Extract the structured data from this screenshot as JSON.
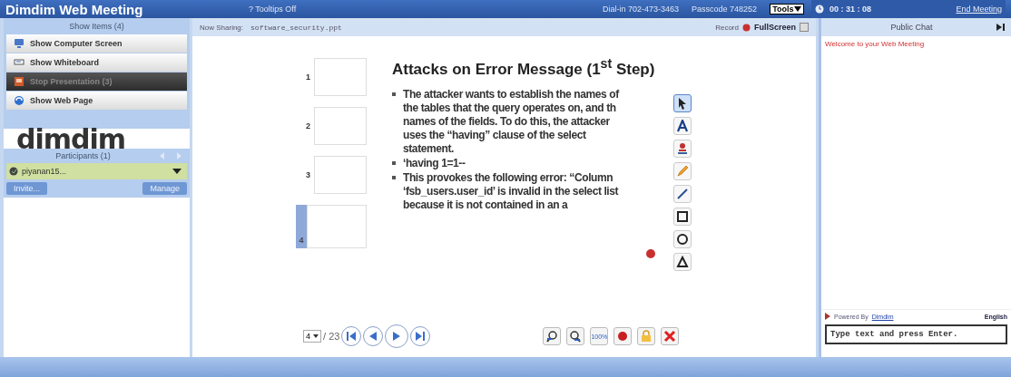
{
  "window": {
    "title": "Dimdim Web Meeting"
  },
  "header": {
    "tooltips": "? Tooltips Off",
    "dial_in": "Dial-in  702-473-3463",
    "passcode": "Passcode  748252",
    "tools": "Tools",
    "timer": "00 : 31 : 08",
    "end_meeting": "End Meeting"
  },
  "show_items": {
    "title": "Show Items (4)",
    "items": [
      {
        "kind": "screen",
        "label": "Show Computer Screen",
        "selected": false
      },
      {
        "kind": "whiteboard",
        "label": "Show Whiteboard",
        "selected": false
      },
      {
        "kind": "presentation",
        "label": "Stop Presentation (3)",
        "selected": true
      },
      {
        "kind": "web",
        "label": "Show Web Page",
        "selected": false
      }
    ]
  },
  "logo": "dimdim",
  "participants": {
    "title": "Participants (1)",
    "people": [
      {
        "name": "piyanan15..."
      }
    ],
    "buttons": [
      "Invite...",
      "Manage"
    ]
  },
  "sharing": {
    "label": "Now Sharing:",
    "file": "software_security.ppt",
    "record": "Record",
    "fullscreen": "FullScreen"
  },
  "thumbnails": [
    {
      "number": "1",
      "selected": false
    },
    {
      "number": "2",
      "selected": false
    },
    {
      "number": "3",
      "selected": false
    },
    {
      "number": "4",
      "selected": true
    }
  ],
  "slide": {
    "title": "Attacks on Error Message (1$^{st}$ Step)",
    "bullets": [
      "The attacker wants to establish the names of\nthe tables that the query operates on, and th\nnames of the fields. To do this, the attacker\nuses the “having” clause of the select\nstatement.",
      "‘having 1=1--",
      "This provokes the following error: “Column\n‘fsb_users.user_id’ is invalid in the select list\nbecause it is not contained in an a"
    ]
  },
  "draw_tools": [
    {
      "kind": "pointer",
      "selected": true
    },
    {
      "kind": "text",
      "selected": false
    },
    {
      "kind": "stamp",
      "selected": false
    },
    {
      "kind": "pencil",
      "selected": false
    },
    {
      "kind": "line",
      "selected": false
    },
    {
      "kind": "rect",
      "selected": false
    },
    {
      "kind": "circle",
      "selected": false
    },
    {
      "kind": "triangle",
      "selected": false
    }
  ],
  "pager": {
    "page": "4",
    "total": "/ 23"
  },
  "bottom_tools": [
    {
      "kind": "zoom-in"
    },
    {
      "kind": "zoom-out"
    },
    {
      "kind": "fit",
      "label": "100%"
    },
    {
      "kind": "record"
    },
    {
      "kind": "lock"
    },
    {
      "kind": "close"
    }
  ],
  "chat": {
    "title": "Public Chat",
    "messages": [
      "Welcome to your Web Meeting"
    ],
    "powered": "Powered By",
    "powered_link": "Dimdim",
    "language": "English",
    "placeholder": "Type text and press Enter."
  }
}
